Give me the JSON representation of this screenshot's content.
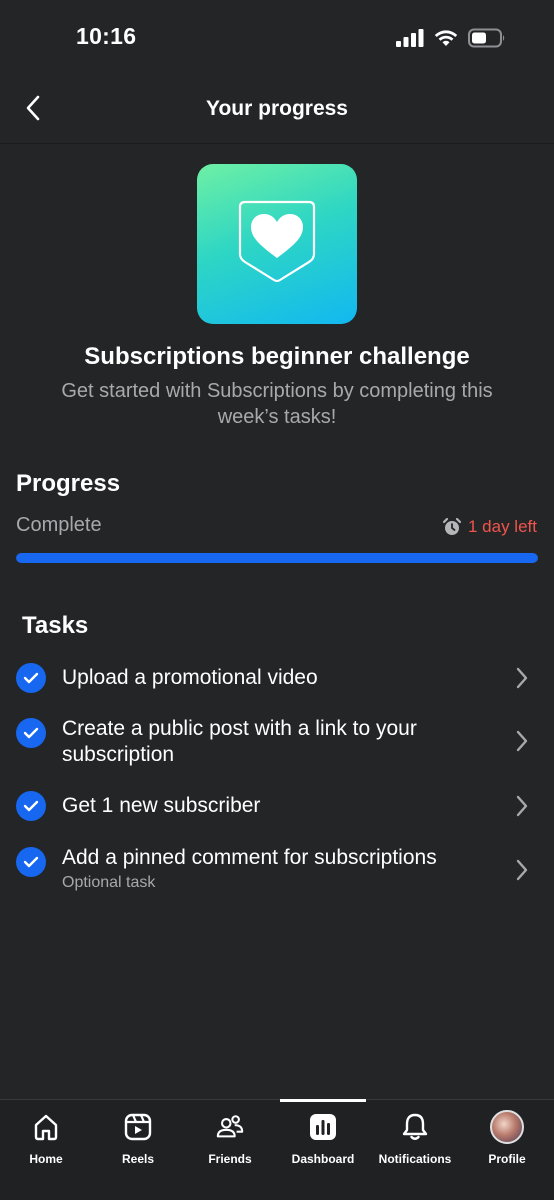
{
  "status_bar": {
    "time": "10:16"
  },
  "header": {
    "title": "Your progress"
  },
  "challenge": {
    "title": "Subscriptions beginner challenge",
    "description": "Get started with Subscriptions by completing this week’s tasks!"
  },
  "progress": {
    "heading": "Progress",
    "status": "Complete",
    "time_left": "1 day left",
    "fraction": 1.0
  },
  "tasks": {
    "heading": "Tasks",
    "items": [
      {
        "label": "Upload a promotional video",
        "sub": "",
        "done": true
      },
      {
        "label": "Create a public post with a link to your subscription",
        "sub": "",
        "done": true
      },
      {
        "label": "Get 1 new subscriber",
        "sub": "",
        "done": true
      },
      {
        "label": "Add a pinned comment for subscriptions",
        "sub": "Optional task",
        "done": true
      }
    ]
  },
  "tabbar": {
    "active": "Dashboard",
    "items": [
      {
        "label": "Home",
        "icon": "home-icon"
      },
      {
        "label": "Reels",
        "icon": "reels-icon"
      },
      {
        "label": "Friends",
        "icon": "friends-icon"
      },
      {
        "label": "Dashboard",
        "icon": "dashboard-icon"
      },
      {
        "label": "Notifications",
        "icon": "bell-icon"
      },
      {
        "label": "Profile",
        "icon": "avatar"
      }
    ]
  },
  "colors": {
    "background": "#242527",
    "accent": "#1767f1",
    "warning": "#f0544c",
    "muted_text": "#a7a9ad"
  }
}
